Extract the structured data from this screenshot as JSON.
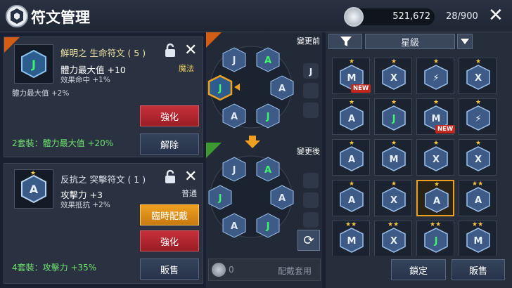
{
  "header": {
    "title": "符文管理",
    "currency": "521,672",
    "capacity": "28/900"
  },
  "card1": {
    "name": "鮮明之 生命符文 ( 5 )",
    "stat_main": "體力最大值 +10",
    "stat_sub": "效果命中 +1%",
    "extra": "體力最大值 +2%",
    "type": "魔法",
    "btn_enhance": "強化",
    "btn_remove": "解除",
    "set_bonus": "2套裝：體力最大值 +20%"
  },
  "card2": {
    "name": "反抗之 突擊符文 ( 1 )",
    "stat_main": "攻擊力 +3",
    "stat_sub": "效果抵抗 +2%",
    "type": "普通",
    "btn_temp": "臨時配戴",
    "btn_enhance": "強化",
    "btn_sell": "販售",
    "set_bonus": "4套裝：攻擊力 +35%"
  },
  "middle": {
    "before": "變更前",
    "after": "變更後",
    "cost": "0",
    "apply": "配戴套用"
  },
  "right": {
    "sort": "星級",
    "btn_lock": "鎖定",
    "btn_sell": "販售",
    "new_label": "NEW"
  },
  "colors": {
    "accent": "#e36a17",
    "gold": "#f0a020",
    "green_set": "#6fe06f",
    "red": "#c7303a"
  },
  "grid": [
    {
      "stars": 1,
      "sym": "M",
      "new": true
    },
    {
      "stars": 1,
      "sym": "X",
      "new": false
    },
    {
      "stars": 1,
      "sym": "bolt",
      "new": false
    },
    {
      "stars": 1,
      "sym": "X",
      "new": false
    },
    {
      "stars": 1,
      "sym": "A",
      "new": false
    },
    {
      "stars": 1,
      "sym": "J",
      "new": false
    },
    {
      "stars": 1,
      "sym": "M",
      "new": true
    },
    {
      "stars": 1,
      "sym": "bolt",
      "new": false
    },
    {
      "stars": 1,
      "sym": "A",
      "new": false
    },
    {
      "stars": 1,
      "sym": "M",
      "new": false
    },
    {
      "stars": 1,
      "sym": "X",
      "new": false
    },
    {
      "stars": 1,
      "sym": "X",
      "new": false
    },
    {
      "stars": 1,
      "sym": "A",
      "new": false
    },
    {
      "stars": 1,
      "sym": "X",
      "new": false
    },
    {
      "stars": 1,
      "sym": "A",
      "new": false,
      "selected": true
    },
    {
      "stars": 2,
      "sym": "A",
      "new": false
    },
    {
      "stars": 2,
      "sym": "M",
      "new": false
    },
    {
      "stars": 2,
      "sym": "X",
      "new": false
    },
    {
      "stars": 2,
      "sym": "J",
      "new": false
    },
    {
      "stars": 2,
      "sym": "M",
      "new": false
    }
  ]
}
